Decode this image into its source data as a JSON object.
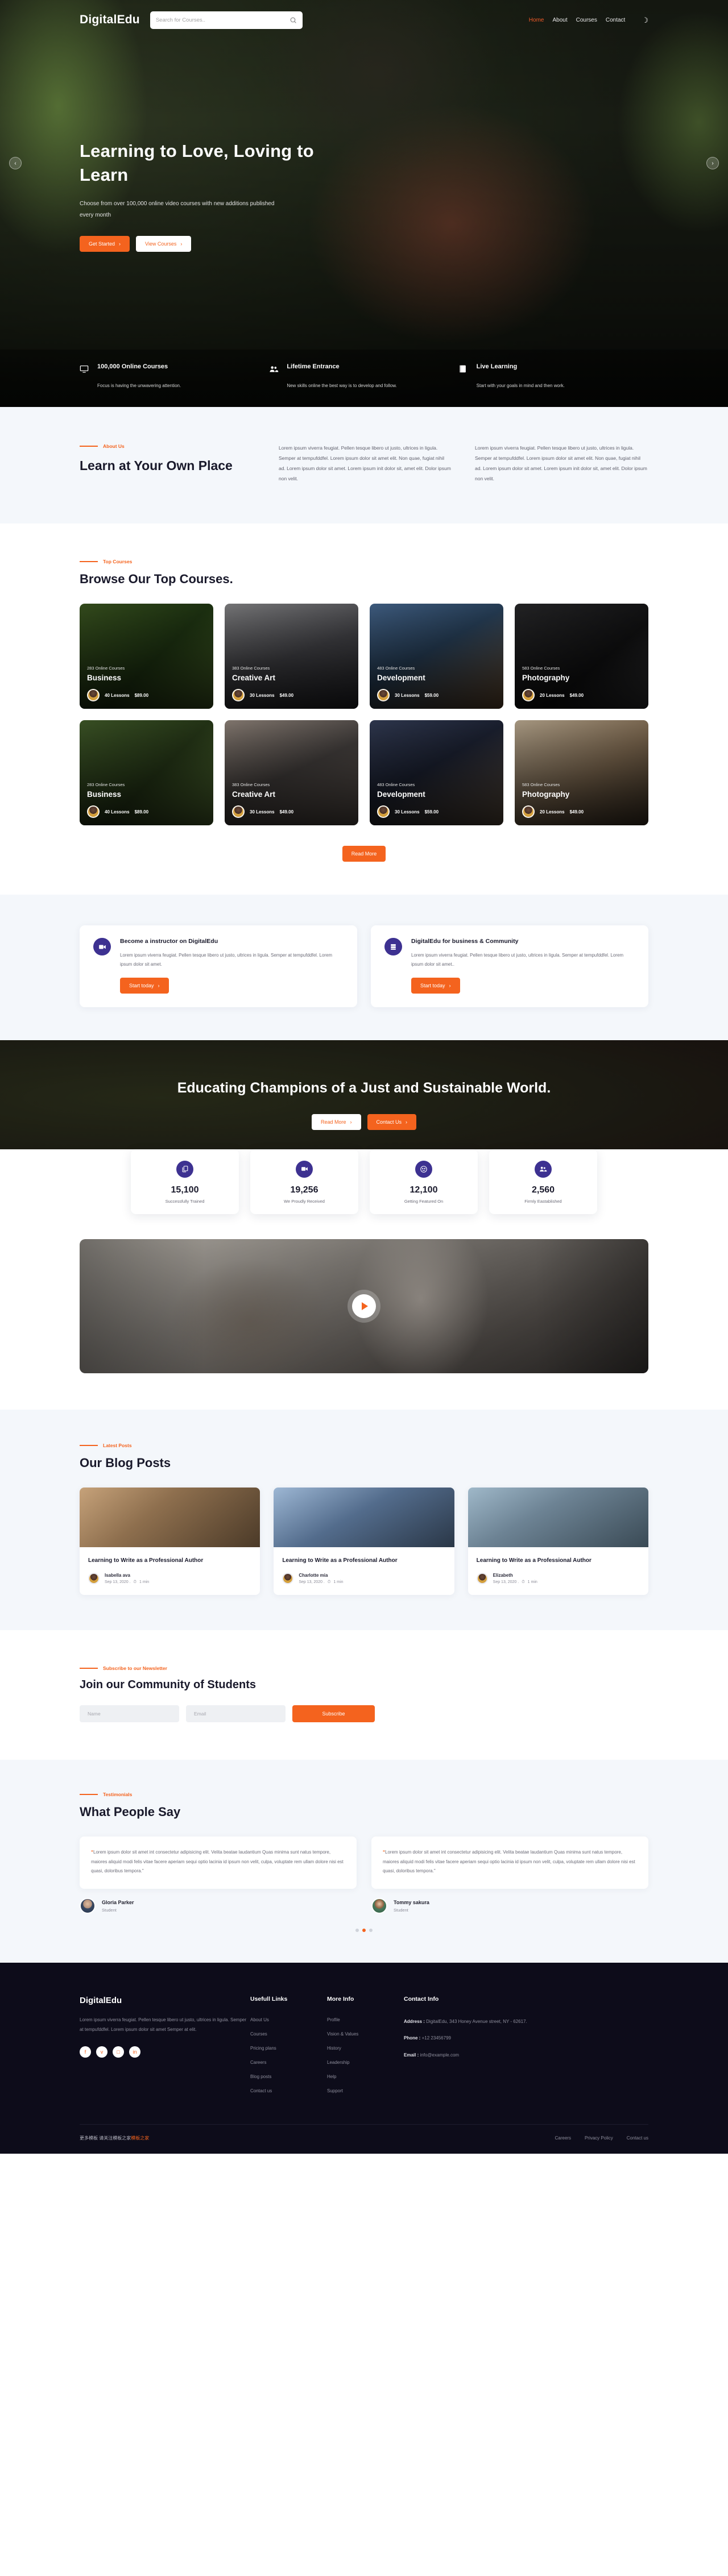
{
  "brand": {
    "name": "DigitalEdu"
  },
  "header": {
    "search": {
      "placeholder": "Search for Courses..",
      "value": "",
      "icon": "search-icon"
    },
    "nav": [
      {
        "label": "Home",
        "active": true
      },
      {
        "label": "About",
        "active": false
      },
      {
        "label": "Courses",
        "active": false
      },
      {
        "label": "Contact",
        "active": false
      }
    ],
    "theme_toggle_icon": "moon-icon"
  },
  "hero": {
    "title": "Learning to Love, Loving to Learn",
    "subtitle": "Choose from over 100,000 online video courses with new additions published every month",
    "primary_cta": "Get Started",
    "secondary_cta": "View Courses",
    "prev_label": "‹",
    "next_label": "›"
  },
  "features": [
    {
      "icon": "monitor-icon",
      "title": "100,000 Online Courses",
      "text": "Focus is having the unwavering attention."
    },
    {
      "icon": "users-icon",
      "title": "Lifetime Entrance",
      "text": "New skills online the best way is to develop and follow."
    },
    {
      "icon": "book-icon",
      "title": "Live Learning",
      "text": "Start with your goals in mind and then work."
    }
  ],
  "about": {
    "eyebrow": "About Us",
    "title": "Learn at Your Own Place",
    "paragraphs": [
      "Lorem ipsum viverra feugiat. Pellen tesque libero ut justo, ultrices in ligula. Semper at tempufddfel. Lorem ipsum dolor sit amet elit. Non quae, fugiat nihil ad. Lorem ipsum dolor sit amet. Lorem ipsum init dolor sit, amet elit. Dolor ipsum non velit.",
      "Lorem ipsum viverra feugiat. Pellen tesque libero ut justo, ultrices in ligula. Semper at tempufddfel. Lorem ipsum dolor sit amet elit. Non quae, fugiat nihil ad. Lorem ipsum dolor sit amet. Lorem ipsum init dolor sit, amet elit. Dolor ipsum non velit."
    ]
  },
  "top_courses": {
    "eyebrow": "Top Courses",
    "title": "Browse Our Top Courses.",
    "read_more": "Read More",
    "row1": [
      {
        "count": "283 Online Courses",
        "name": "Business",
        "lessons": "40 Lessons",
        "price": "$89.00",
        "img": "img-biz1"
      },
      {
        "count": "383 Online Courses",
        "name": "Creative Art",
        "lessons": "30 Lessons",
        "price": "$49.00",
        "img": "img-art1"
      },
      {
        "count": "483 Online Courses",
        "name": "Development",
        "lessons": "30 Lessons",
        "price": "$59.00",
        "img": "img-dev1"
      },
      {
        "count": "583 Online Courses",
        "name": "Photography",
        "lessons": "20 Lessons",
        "price": "$49.00",
        "img": "img-pho1"
      }
    ],
    "row2": [
      {
        "count": "283 Online Courses",
        "name": "Business",
        "lessons": "40 Lessons",
        "price": "$89.00",
        "img": "img-biz2"
      },
      {
        "count": "383 Online Courses",
        "name": "Creative Art",
        "lessons": "30 Lessons",
        "price": "$49.00",
        "img": "img-art2"
      },
      {
        "count": "483 Online Courses",
        "name": "Development",
        "lessons": "30 Lessons",
        "price": "$59.00",
        "img": "img-dev2"
      },
      {
        "count": "583 Online Courses",
        "name": "Photography",
        "lessons": "20 Lessons",
        "price": "$49.00",
        "img": "img-pho2"
      }
    ]
  },
  "promos": [
    {
      "icon": "video-camera-icon",
      "title": "Become a instructor on DigitalEdu",
      "text": "Lorem ipsum viverra feugiat. Pellen tesque libero ut justo, ultrices in ligula. Semper at tempufddfel. Lorem ipsum dolor sit amet.",
      "cta": "Start today"
    },
    {
      "icon": "server-icon",
      "title": "DigitalEdu for business & Community",
      "text": "Lorem ipsum viverra feugiat. Pellen tesque libero ut justo, ultrices in ligula. Semper at tempufddfel. Lorem ipsum dolor sit amet..",
      "cta": "Start today"
    }
  ],
  "banner": {
    "title": "Educating Champions of a Just and Sustainable World.",
    "primary_cta": "Read More",
    "secondary_cta": "Contact Us"
  },
  "stats": [
    {
      "icon": "copy-icon",
      "number": "15,100",
      "label": "Successfully Trained"
    },
    {
      "icon": "video-camera-icon",
      "number": "19,256",
      "label": "We Proudly Received"
    },
    {
      "icon": "smile-icon",
      "number": "12,100",
      "label": "Getting Featured On"
    },
    {
      "icon": "users-icon",
      "number": "2,560",
      "label": "Firmly Eastablished"
    }
  ],
  "video": {
    "play_label": "play-button"
  },
  "blog": {
    "eyebrow": "Latest Posts",
    "title": "Our Blog Posts",
    "posts": [
      {
        "title": "Learning to Write as a Professional Author",
        "author": "Isabella ava",
        "date": "Sep 13, 2020 .",
        "read": "1 min",
        "img": "bimg1"
      },
      {
        "title": "Learning to Write as a Professional Author",
        "author": "Charlotte mia",
        "date": "Sep 13, 2020 .",
        "read": "1 min",
        "img": "bimg2"
      },
      {
        "title": "Learning to Write as a Professional Author",
        "author": "Elizabeth",
        "date": "Sep 13, 2020 .",
        "read": "1 min",
        "img": "bimg3"
      }
    ]
  },
  "newsletter": {
    "eyebrow": "Subscribe to our Newsletter",
    "title": "Join our Community of Students",
    "name_placeholder": "Name",
    "email_placeholder": "Email",
    "name_value": "",
    "email_value": "",
    "button": "Subscribe"
  },
  "testimonials": {
    "eyebrow": "Testimonials",
    "title": "What People Say",
    "items": [
      {
        "quote": "Lorem ipsum dolor sit amet int consectetur adipisicing elit. Velita beatae laudantium Quas minima sunt natus tempore, maiores aliquid modi felis vitae facere aperiam sequi optio lacinia id ipsum non velit, culpa, voluptate rem ullam dolore nisi est quasi, doloribus tempora.\"",
        "name": "Gloria Parker",
        "role": "Student"
      },
      {
        "quote": "Lorem ipsum dolor sit amet int consectetur adipisicing elit. Velita beatae laudantium Quas minima sunt natus tempore, maiores aliquid modi felis vitae facere aperiam sequi optio lacinia id ipsum non velit, culpa, voluptate rem ullam dolore nisi est quasi, doloribus tempora.\"",
        "name": "Tommy sakura",
        "role": "Student"
      }
    ],
    "active_dot": 1
  },
  "footer": {
    "brand": "DigitalEdu",
    "about": "Lorem ipsum viverra feugiat. Pellen tesque libero ut justo, ultrices in ligula. Semper at tempufddfel. Lorem ipsum dolor sit amet Semper at elit.",
    "socials": [
      {
        "icon": "facebook-icon",
        "glyph": "f"
      },
      {
        "icon": "twitter-icon",
        "glyph": "ᴠ"
      },
      {
        "icon": "instagram-icon",
        "glyph": "□"
      },
      {
        "icon": "linkedin-icon",
        "glyph": "in"
      }
    ],
    "useful": {
      "title": "Usefull Links",
      "links": [
        "About Us",
        "Courses",
        "Pricing plans",
        "Careers",
        "Blog posts",
        "Contact us"
      ]
    },
    "more": {
      "title": "More Info",
      "links": [
        "Profile",
        "Vision & Values",
        "History",
        "Leadership",
        "Help",
        "Support"
      ]
    },
    "contact": {
      "title": "Contact Info",
      "address_label": "Address :",
      "address": "DigitalEdu, 343 Honey Avenue street, NY - 62617.",
      "phone_label": "Phone :",
      "phone": "+12 23456799",
      "email_label": "Email :",
      "email": "info@example.com"
    },
    "bottom": {
      "credit_prefix": "更多模板 请关注模板之家",
      "credit_highlight": "模板之家",
      "links": [
        "Careers",
        "Privacy Policy",
        "Contact us"
      ]
    }
  },
  "colors": {
    "accent": "#f4631e",
    "indigo": "#3d3191",
    "dark": "#0d0c1a",
    "light": "#f4f7fb"
  }
}
